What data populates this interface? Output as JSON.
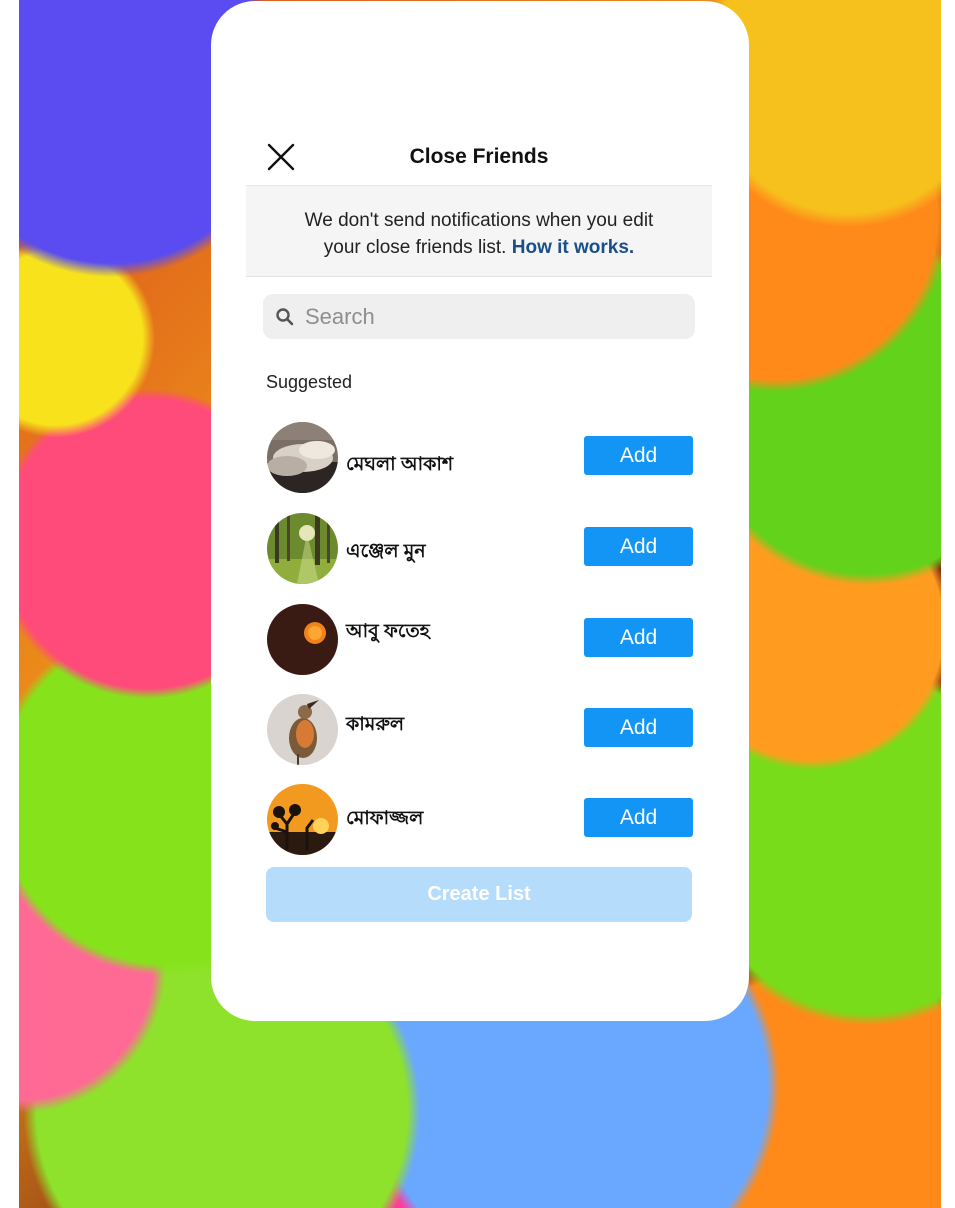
{
  "colors": {
    "accent": "#1395f6",
    "link": "#1a4f8a",
    "create_disabled": "#b5dcfb",
    "notice_bg": "#f5f5f5"
  },
  "header": {
    "close_icon": "close-icon",
    "title": "Close Friends"
  },
  "notice": {
    "line1": "We don't send notifications when you edit",
    "line2_prefix": "your close friends list.",
    "link": "How it works."
  },
  "search": {
    "icon": "search-icon",
    "placeholder": "Search"
  },
  "suggested": {
    "label": "Suggested",
    "users": [
      {
        "name": "মেঘলা আকাশ",
        "avatar": "clouds-photo",
        "add_label": "Add"
      },
      {
        "name": "এঞ্জেল মুন",
        "avatar": "forest-photo",
        "add_label": "Add"
      },
      {
        "name": "আবু ফতেহ",
        "avatar": "sunset-sun-photo",
        "add_label": "Add"
      },
      {
        "name": "কামরুল",
        "avatar": "robin-bird-photo",
        "add_label": "Add"
      },
      {
        "name": "মোফাজ্জল",
        "avatar": "desert-tree-sunset-photo",
        "add_label": "Add"
      }
    ]
  },
  "create_button": {
    "label": "Create List",
    "state": "disabled"
  }
}
